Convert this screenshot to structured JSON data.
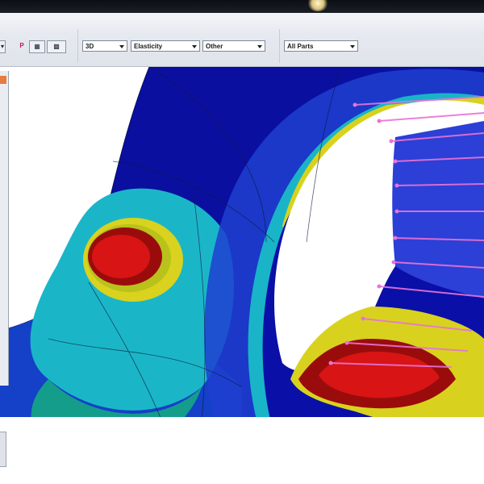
{
  "toolbar": {
    "view_mode": "3D",
    "study_type": "Elasticity",
    "category": "Other",
    "scope": "All Parts",
    "p_label": "P"
  },
  "icons": [
    "window-glow-icon",
    "dropdown-arrow-icon",
    "p-tool-icon",
    "mesh-tool-icon",
    "display-tool-icon"
  ],
  "colors": {
    "deep_blue": "#0a0fa8",
    "blue": "#1f3fd0",
    "cyan": "#19b4c8",
    "teal": "#14a08c",
    "yellow": "#d8d21e",
    "red": "#d81414",
    "dark_red": "#9a0c0c",
    "load_arrows": "#e873d8"
  }
}
